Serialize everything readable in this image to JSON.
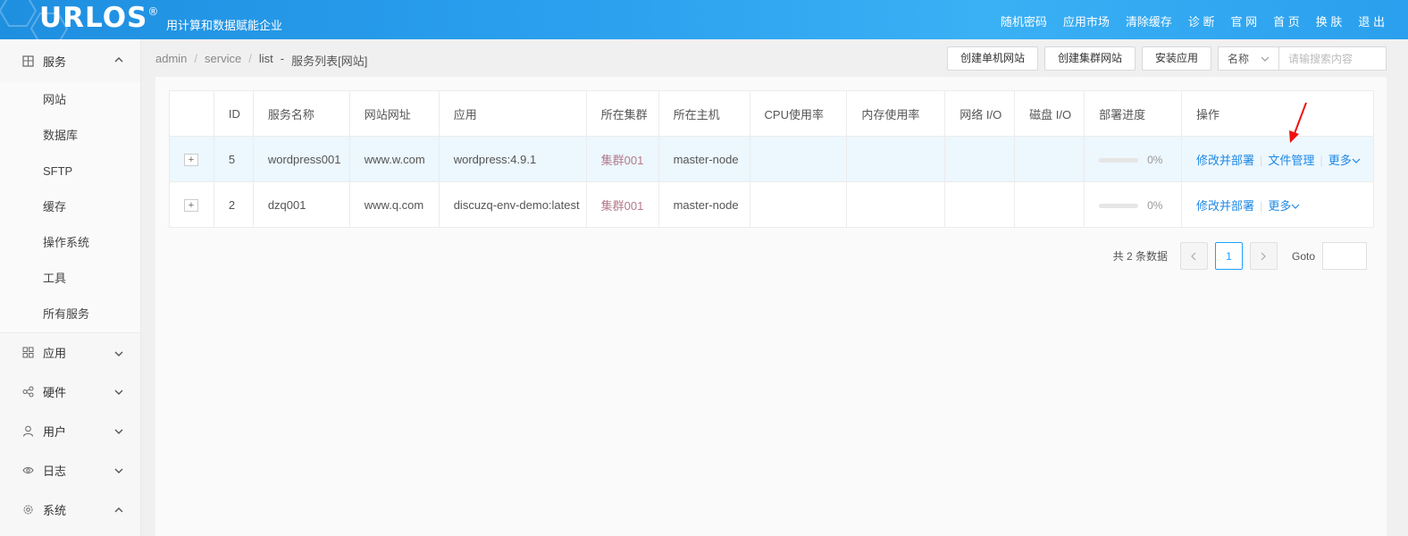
{
  "header": {
    "logo": "URLOS",
    "logo_mark": "®",
    "slogan": "用计算和数据赋能企业",
    "nav": [
      "随机密码",
      "应用市场",
      "清除缓存",
      "诊 断",
      "官 网",
      "首 页",
      "换 肤",
      "退 出"
    ]
  },
  "sidebar": {
    "groups": [
      {
        "label": "服务",
        "icon": "grid-icon",
        "expanded": true,
        "items": [
          "网站",
          "数据库",
          "SFTP",
          "缓存",
          "操作系统",
          "工具",
          "所有服务"
        ]
      },
      {
        "label": "应用",
        "icon": "apps-icon",
        "expanded": false
      },
      {
        "label": "硬件",
        "icon": "share-icon",
        "expanded": false
      },
      {
        "label": "用户",
        "icon": "user-icon",
        "expanded": false
      },
      {
        "label": "日志",
        "icon": "eye-icon",
        "expanded": false
      },
      {
        "label": "系统",
        "icon": "settings-icon",
        "expanded": true
      }
    ]
  },
  "breadcrumb": {
    "items": [
      "admin",
      "service",
      "list"
    ],
    "current": "服务列表[网站]",
    "sep": "/",
    "dash": "-"
  },
  "toolbar": {
    "create_single": "创建单机网站",
    "create_cluster": "创建集群网站",
    "install_app": "安装应用",
    "search_field": "名称",
    "search_placeholder": "请输搜索内容"
  },
  "table": {
    "headers": [
      "",
      "ID",
      "服务名称",
      "网站网址",
      "应用",
      "所在集群",
      "所在主机",
      "CPU使用率",
      "内存使用率",
      "网络 I/O",
      "磁盘 I/O",
      "部署进度",
      "操作"
    ],
    "rows": [
      {
        "expand": "+",
        "id": "5",
        "name": "wordpress001",
        "url": "www.w.com",
        "app": "wordpress:4.9.1",
        "cluster": "集群001",
        "host": "master-node",
        "cpu": "",
        "mem": "",
        "net": "",
        "disk": "",
        "progress": 0,
        "progress_label": "0%",
        "ops": [
          "修改并部署",
          "文件管理",
          "更多"
        ]
      },
      {
        "expand": "+",
        "id": "2",
        "name": "dzq001",
        "url": "www.q.com",
        "app": "discuzq-env-demo:latest",
        "cluster": "集群001",
        "host": "master-node",
        "cpu": "",
        "mem": "",
        "net": "",
        "disk": "",
        "progress": 0,
        "progress_label": "0%",
        "ops": [
          "修改并部署",
          "更多"
        ]
      }
    ]
  },
  "pagination": {
    "total_label": "共 2 条数据",
    "current_page": "1",
    "goto_label": "Goto"
  },
  "colors": {
    "accent": "#1e9fff",
    "link": "#1e88e5",
    "cluster": "#b57a8a",
    "row_highlight": "#ecf7fe",
    "annotation": "#ee1111"
  }
}
